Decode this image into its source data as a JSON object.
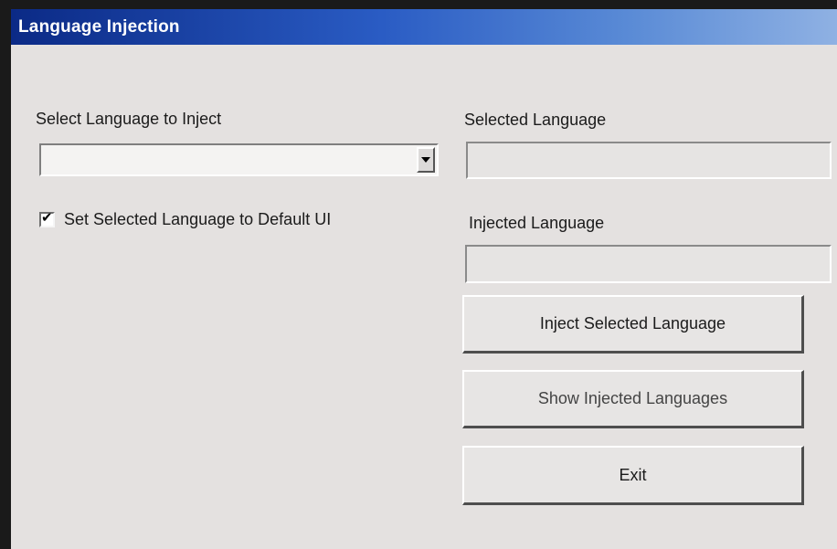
{
  "window": {
    "title": "Language Injection"
  },
  "left": {
    "select_label": "Select Language to Inject",
    "select_value": "",
    "checkbox": {
      "label": "Set Selected Language to Default UI",
      "checked": true
    }
  },
  "right": {
    "selected_language_label": "Selected Language",
    "selected_language_value": "",
    "injected_language_label": "Injected Language",
    "injected_language_value": "",
    "inject_button": "Inject Selected Language",
    "show_button": "Show Injected Languages",
    "exit_button": "Exit"
  },
  "icons": {
    "dropdown": "chevron-down-icon",
    "check": "checkmark-icon"
  }
}
